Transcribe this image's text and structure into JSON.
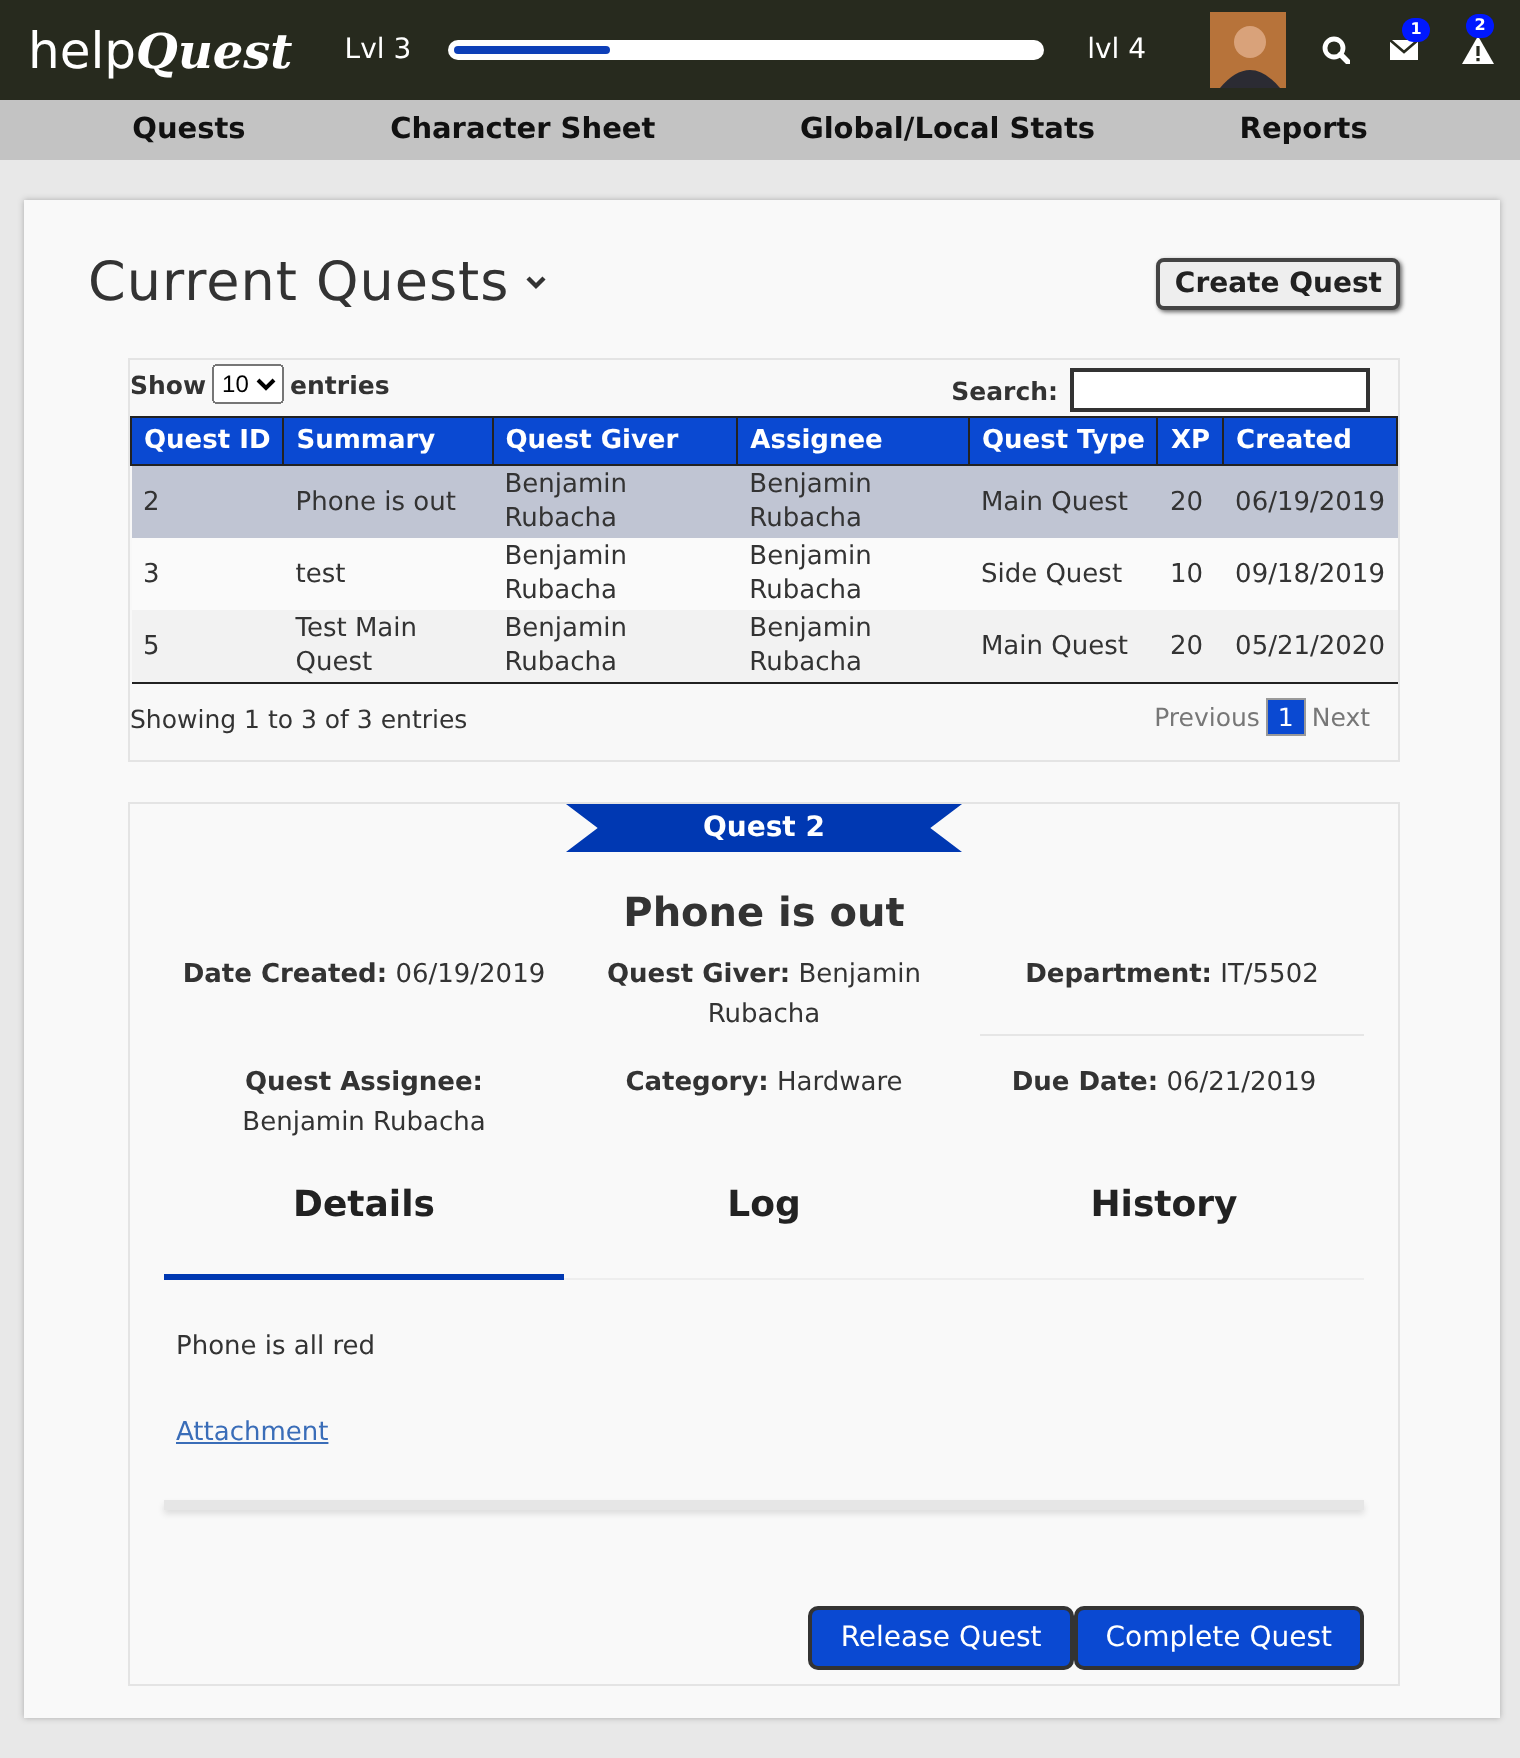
{
  "header": {
    "logo": [
      "help",
      "Quest"
    ],
    "level_current": "Lvl 3",
    "level_next": "lvl 4",
    "xp_bar": {
      "level": 0.27
    },
    "messages_badge": "1",
    "alerts_badge": "2"
  },
  "nav": [
    "Quests",
    "Character Sheet",
    "Global/Local Stats",
    "Reports"
  ],
  "page": {
    "title": "Current Quests",
    "create_button": "Create Quest"
  },
  "table": {
    "show_label": "Show",
    "entries_value": "10",
    "entries_label": "entries",
    "search_label": "Search:",
    "columns": [
      "Quest ID",
      "Summary",
      "Quest Giver",
      "Assignee",
      "Quest Type",
      "XP",
      "Created"
    ],
    "rows": [
      {
        "selected": true,
        "cells": [
          "2",
          "Phone is out",
          "Benjamin Rubacha",
          "Benjamin Rubacha",
          "Main Quest",
          "20",
          "06/19/2019"
        ]
      },
      {
        "selected": false,
        "cells": [
          "3",
          "test",
          "Benjamin Rubacha",
          "Benjamin Rubacha",
          "Side Quest",
          "10",
          "09/18/2019"
        ]
      },
      {
        "selected": false,
        "cells": [
          "5",
          "Test Main Quest",
          "Benjamin Rubacha",
          "Benjamin Rubacha",
          "Main Quest",
          "20",
          "05/21/2020"
        ]
      }
    ],
    "info": "Showing 1 to 3 of 3 entries",
    "previous": "Previous",
    "pages": [
      {
        "label": "1",
        "selected": true
      }
    ],
    "next": "Next"
  },
  "detail": {
    "banner": "Quest 2",
    "title": "Phone is out",
    "fields": [
      "**Date Created:** 06/19/2019",
      "**Quest Giver:** Benjamin Rubacha",
      "**Department:** IT/5502",
      "**Quest Assignee:** Benjamin Rubacha",
      "**Category:** Hardware",
      "**Due Date:** 06/21/2019"
    ],
    "tabs": [
      {
        "label": "Details",
        "selected": true
      },
      {
        "label": "Log",
        "selected": false
      },
      {
        "label": "History",
        "selected": false
      }
    ],
    "description": "Phone is all red",
    "attachment": "Attachment",
    "buttons": [
      "Release Quest",
      "Complete Quest"
    ]
  }
}
